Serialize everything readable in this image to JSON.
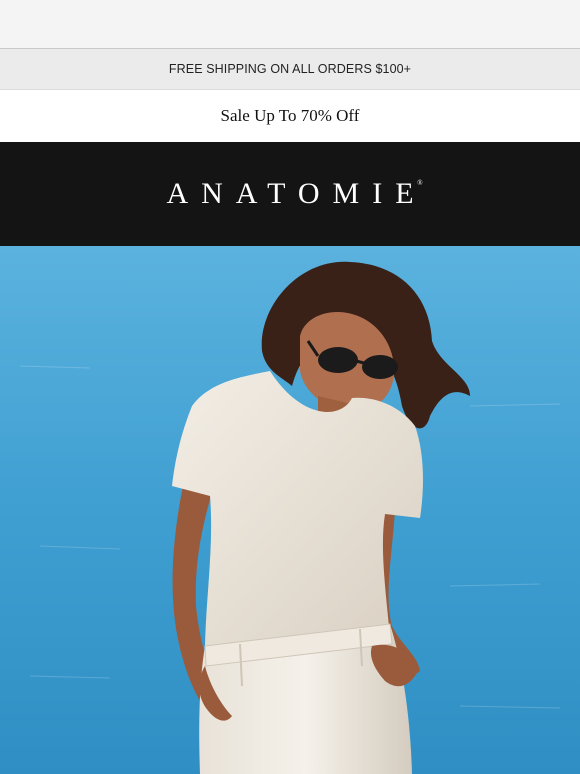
{
  "announcement": {
    "shipping_text": "FREE SHIPPING ON ALL ORDERS $100+"
  },
  "promo": {
    "sale_text": "Sale Up To 70% Off"
  },
  "brand": {
    "logo_text": "ANATOMIE",
    "registered_mark": "®"
  },
  "hero": {
    "image": "woman-in-white-tee-and-trousers-by-sea-photo"
  },
  "colors": {
    "header_bg": "#141414",
    "shipbar_bg": "#ebebeb",
    "sea": "#4aa6d4"
  }
}
